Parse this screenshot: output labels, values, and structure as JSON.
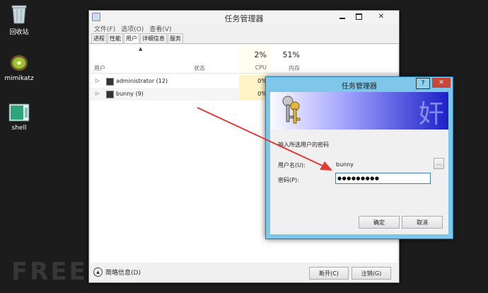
{
  "desktop": {
    "icons": [
      {
        "label": "回收站",
        "icon": "recycle-bin-icon"
      },
      {
        "label": "mimikatz",
        "icon": "kiwi-icon"
      },
      {
        "label": "shell",
        "icon": "file-icon"
      }
    ]
  },
  "task_manager": {
    "title": "任务管理器",
    "menu": [
      "文件(F)",
      "选项(O)",
      "查看(V)"
    ],
    "tabs": [
      "进程",
      "性能",
      "用户",
      "详细信息",
      "服务"
    ],
    "active_tab": "用户",
    "columns": {
      "user": "用户",
      "status": "状态",
      "cpu_pct": "2%",
      "cpu": "CPU",
      "mem_pct": "51%",
      "mem": "内存"
    },
    "rows": [
      {
        "name": "administrator (12)",
        "cpu": "0%"
      },
      {
        "name": "bunny (9)",
        "cpu": "0%"
      }
    ],
    "footer": {
      "less_details": "简略信息(D)",
      "disconnect": "断开(C)",
      "logoff": "注销(G)"
    }
  },
  "dialog": {
    "title": "任务管理器",
    "help": "?",
    "close": "✕",
    "prompt": "输入所选用户的密码",
    "username_label": "用户名(U):",
    "username_value": "bunny",
    "browse": "...",
    "password_label": "密码(P):",
    "password_value": "●●●●●●●●●",
    "ok": "确定",
    "cancel": "取消"
  },
  "watermark": "FREEBUF"
}
